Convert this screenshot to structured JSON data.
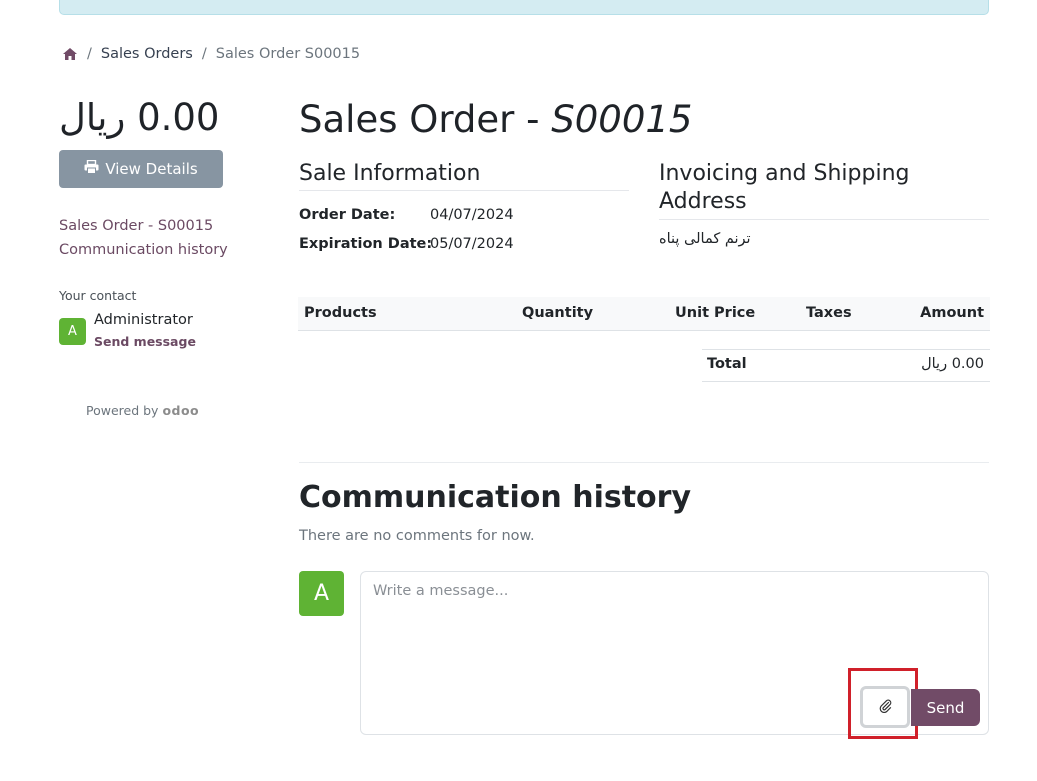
{
  "breadcrumb": {
    "home_icon": "home-icon",
    "items": [
      "Sales Orders",
      "Sales Order S00015"
    ]
  },
  "sidebar": {
    "amount": "0.00 ریال",
    "view_details": "View Details",
    "view_details_icon": "printer-icon",
    "links": [
      "Sales Order - S00015",
      "Communication history"
    ],
    "contact_label": "Your contact",
    "contact_initial": "A",
    "contact_name": "Administrator",
    "contact_action": "Send message",
    "powered_by": "Powered by",
    "powered_brand": "odoo"
  },
  "order": {
    "title_prefix": "Sales Order - ",
    "reference": "S00015",
    "sale_info_heading": "Sale Information",
    "order_date_label": "Order Date:",
    "order_date": "04/07/2024",
    "expiration_label": "Expiration Date:",
    "expiration_date": "05/07/2024",
    "address_heading_line1": "Invoicing and Shipping",
    "address_heading_line2": "Address",
    "address_name": "ترنم کمالی پناه"
  },
  "table": {
    "columns": [
      "Products",
      "Quantity",
      "Unit Price",
      "Taxes",
      "Amount"
    ],
    "total_label": "Total",
    "total_value": "0.00 ریال"
  },
  "communication": {
    "title": "Communication history",
    "empty_text": "There are no comments for now.",
    "avatar_initial": "A",
    "placeholder": "Write a message...",
    "attach_icon": "paperclip-icon",
    "send_label": "Send"
  },
  "colors": {
    "brand": "#714b67",
    "avatar": "#5fb334",
    "view_button": "#8795a2",
    "highlight": "#d0202a",
    "banner": "#d4ecf2"
  }
}
